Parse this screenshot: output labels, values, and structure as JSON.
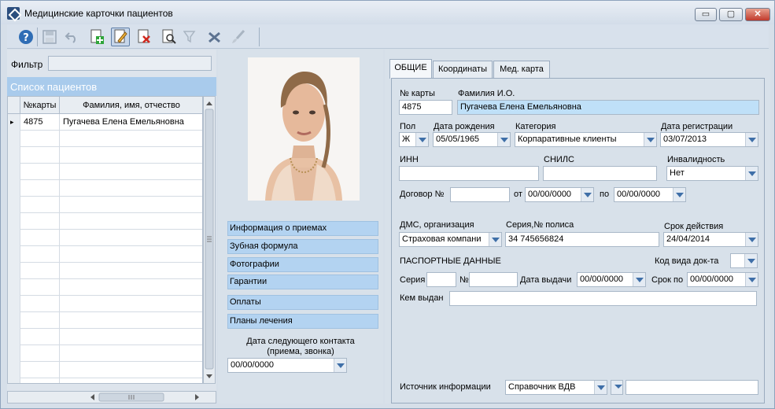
{
  "window": {
    "title": "Медицинские карточки пациентов",
    "controls": {
      "minimize": "▭",
      "restore": "▢",
      "close": "✕"
    }
  },
  "toolbar": {
    "buttons": [
      {
        "name": "help-icon",
        "glyph": "?"
      },
      {
        "name": "save-icon",
        "glyph": "🖫"
      },
      {
        "name": "undo-icon",
        "glyph": "↶"
      },
      {
        "name": "new-record-icon",
        "glyph": "✚"
      },
      {
        "name": "edit-record-icon",
        "glyph": "✎"
      },
      {
        "name": "delete-record-icon",
        "glyph": "✖"
      },
      {
        "name": "search-icon",
        "glyph": "⌕"
      },
      {
        "name": "filter-icon",
        "glyph": "⏷"
      },
      {
        "name": "clear-filter-icon",
        "glyph": "✗"
      },
      {
        "name": "brush-icon",
        "glyph": "🖌"
      }
    ]
  },
  "left": {
    "filter_label": "Фильтр",
    "filter_value": "",
    "list_title": "Список пациентов",
    "columns": [
      "№карты",
      "Фамилия, имя, отчество"
    ],
    "rows": [
      {
        "card": "4875",
        "name": "Пугачева Елена Емельяновна",
        "selected": true
      }
    ],
    "row_marker": "▸"
  },
  "middle": {
    "buttons": [
      "Информация о приемах",
      "Зубная формула",
      "Фотографии",
      "Гарантии",
      "Оплаты",
      "Планы лечения"
    ],
    "next_contact_label_1": "Дата следующего контакта",
    "next_contact_label_2": "(приема, звонка)",
    "next_contact_value": "00/00/0000"
  },
  "tabs": [
    {
      "label": "ОБЩИЕ",
      "selected": true
    },
    {
      "label": "Координаты",
      "selected": false
    },
    {
      "label": "Мед. карта",
      "selected": false
    }
  ],
  "form": {
    "card_no_label": "№ карты",
    "card_no": "4875",
    "fio_label": "Фамилия И.О.",
    "fio": "Пугачева Елена Емельяновна",
    "sex_label": "Пол",
    "sex": "Ж",
    "birth_label": "Дата рождения",
    "birth": "05/05/1965",
    "category_label": "Категория",
    "category": "Корпаративные клиенты",
    "reg_label": "Дата регистрации",
    "reg": "03/07/2013",
    "inn_label": "ИНН",
    "inn": "",
    "snils_label": "СНИЛС",
    "snils": "",
    "disability_label": "Инвалидность",
    "disability": "Нет",
    "contract_label": "Договор №",
    "contract": "",
    "from_label": "от",
    "from": "00/00/0000",
    "to_label": "по",
    "to": "00/00/0000",
    "dms_label": "ДМС, организация",
    "dms": "Страховая компани",
    "policy_label": "Серия,№ полиса",
    "policy": "34 745656824",
    "validity_label": "Срок действия",
    "validity": "24/04/2014",
    "passport_label": "ПАСПОРТНЫЕ ДАННЫЕ",
    "doc_kind_label": "Код вида док-та",
    "doc_kind": "",
    "series_label": "Серия",
    "series": "",
    "number_label": "№",
    "number": "",
    "issue_date_label": "Дата выдачи",
    "issue_date": "00/00/0000",
    "term_label": "Срок по",
    "term": "00/00/0000",
    "issued_by_label": "Кем выдан",
    "issued_by": "",
    "source_label": "Источник информации",
    "source": "Справочник ВДВ",
    "source_extra": ""
  }
}
